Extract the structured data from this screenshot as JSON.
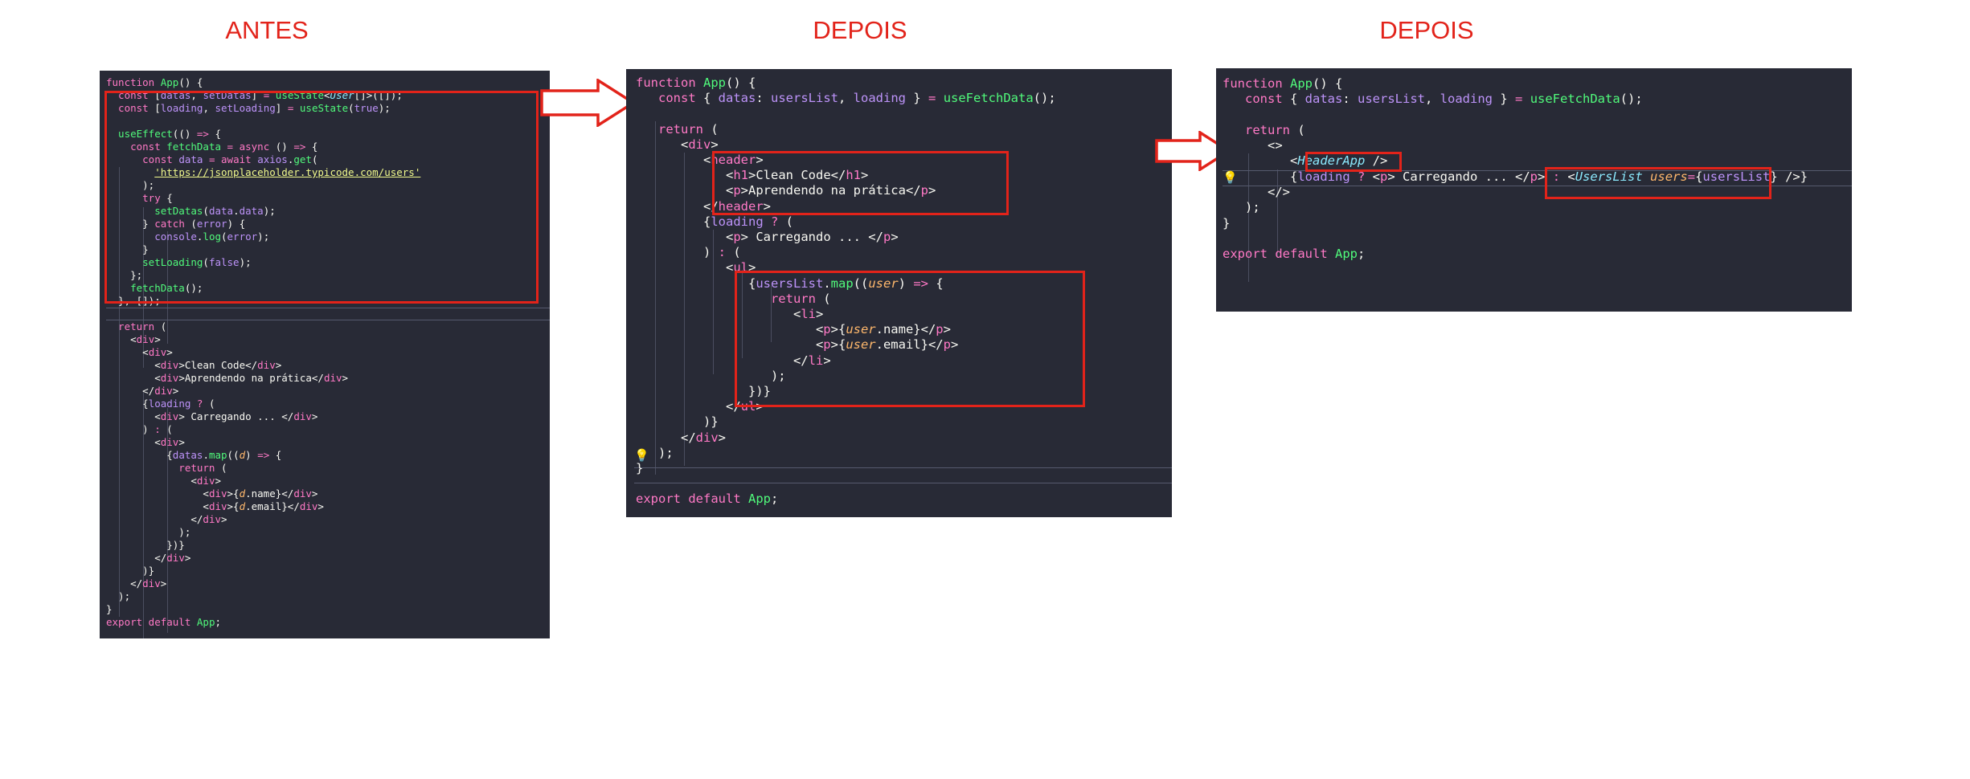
{
  "titles": {
    "before": "ANTES",
    "after_1": "DEPOIS",
    "after_2": "DEPOIS"
  },
  "colors": {
    "highlight": "#e2231a",
    "editor_background": "#282a36"
  },
  "icons": [
    "arrow-right-icon",
    "lightbulb-icon"
  ],
  "code_before": [
    "function App() {",
    "  const [datas, setDatas] = useState<User[]>([]);",
    "  const [loading, setLoading] = useState(true);",
    "",
    "  useEffect(() => {",
    "    const fetchData = async () => {",
    "      const data = await axios.get(",
    "        'https://jsonplaceholder.typicode.com/users'",
    "      );",
    "      try {",
    "        setDatas(data.data);",
    "      } catch (error) {",
    "        console.log(error);",
    "      }",
    "      setLoading(false);",
    "    };",
    "    fetchData();",
    "  }, []);",
    "",
    "  return (",
    "    <div>",
    "      <div>",
    "        <div>Clean Code</div>",
    "        <div>Aprendendo na prática</div>",
    "      </div>",
    "      {loading ? (",
    "        <div> Carregando ... </div>",
    "      ) : (",
    "        <div>",
    "          {datas.map((d) => {",
    "            return (",
    "              <div>",
    "                <div>{d.name}</div>",
    "                <div>{d.email}</div>",
    "              </div>",
    "            );",
    "          })}",
    "        </div>",
    "      )}",
    "    </div>",
    "  );",
    "}",
    "export default App;"
  ],
  "code_after_1": [
    "function App() {",
    "  const { datas: usersList, loading } = useFetchData();",
    "",
    "  return (",
    "    <div>",
    "      <header>",
    "        <h1>Clean Code</h1>",
    "        <p>Aprendendo na prática</p>",
    "      </header>",
    "      {loading ? (",
    "        <p> Carregando ... </p>",
    "      ) : (",
    "        <ul>",
    "          {usersList.map((user) => {",
    "            return (",
    "              <li>",
    "                <p>{user.name}</p>",
    "                <p>{user.email}</p>",
    "              </li>",
    "            );",
    "          })}",
    "        </ul>",
    "      )}",
    "    </div>",
    "  );",
    "}",
    "",
    "export default App;"
  ],
  "code_after_2": [
    "function App() {",
    "  const { datas: usersList, loading } = useFetchData();",
    "",
    "  return (",
    "    <>",
    "      <HeaderApp />",
    "      {loading ? <p> Carregando ... </p> : <UsersList users={usersList} />}",
    "    </>",
    "  );",
    "}",
    "",
    "export default App;"
  ]
}
